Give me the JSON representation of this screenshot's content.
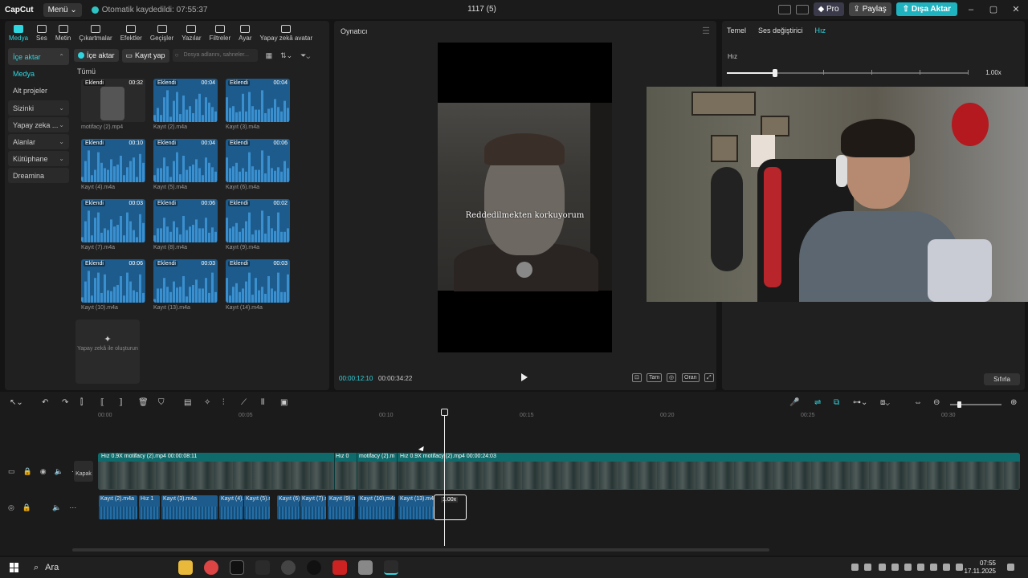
{
  "titlebar": {
    "logo": "CapCut",
    "menu": "Menü",
    "autosave": "Otomatik kaydedildi: 07:55:37",
    "project": "1117 (5)",
    "pro": "Pro",
    "share": "Paylaş",
    "export": "Dışa Aktar"
  },
  "toptabs": [
    {
      "label": "Medya",
      "icon": "media-icon",
      "active": true
    },
    {
      "label": "Ses",
      "icon": "audio-icon"
    },
    {
      "label": "Metin",
      "icon": "text-icon"
    },
    {
      "label": "Çıkartmalar",
      "icon": "sticker-icon"
    },
    {
      "label": "Efektler",
      "icon": "effects-icon"
    },
    {
      "label": "Geçişler",
      "icon": "transitions-icon"
    },
    {
      "label": "Yazılar",
      "icon": "captions-icon"
    },
    {
      "label": "Filtreler",
      "icon": "filters-icon"
    },
    {
      "label": "Ayar",
      "icon": "adjust-icon"
    },
    {
      "label": "Yapay zekâ avatar",
      "icon": "avatar-icon"
    }
  ],
  "sidenav": [
    {
      "label": "İçe aktar",
      "chevron": "^",
      "selected": true
    },
    {
      "label": "Medya",
      "highlight": true
    },
    {
      "label": "Alt projeler"
    },
    {
      "label": "Sizinki",
      "chevron": "v",
      "box": true
    },
    {
      "label": "Yapay zeka ...",
      "chevron": "v",
      "box": true
    },
    {
      "label": "Alanlar",
      "chevron": "v",
      "box": true
    },
    {
      "label": "Kütüphane",
      "chevron": "v",
      "box": true
    },
    {
      "label": "Dreamina",
      "box": true
    }
  ],
  "media_toolbar": {
    "import": "İçe aktar",
    "record": "Kayıt yap",
    "search_placeholder": "Dosya adlarını, sahneler..."
  },
  "section_label": "Tümü",
  "added_label": "Eklendi",
  "media": [
    {
      "name": "motifacy (2).mp4",
      "duration": "00:32",
      "type": "video"
    },
    {
      "name": "Kayıt (2).m4a",
      "duration": "00:04",
      "type": "audio"
    },
    {
      "name": "Kayıt (3).m4a",
      "duration": "00:04",
      "type": "audio"
    },
    {
      "name": "Kayıt (4).m4a",
      "duration": "00:10",
      "type": "audio"
    },
    {
      "name": "Kayıt (5).m4a",
      "duration": "00:04",
      "type": "audio"
    },
    {
      "name": "Kayıt (6).m4a",
      "duration": "00:06",
      "type": "audio"
    },
    {
      "name": "Kayıt (7).m4a",
      "duration": "00:03",
      "type": "audio"
    },
    {
      "name": "Kayıt (8).m4a",
      "duration": "00:06",
      "type": "audio"
    },
    {
      "name": "Kayıt (9).m4a",
      "duration": "00:02",
      "type": "audio"
    },
    {
      "name": "Kayıt (10).m4a",
      "duration": "00:06",
      "type": "audio"
    },
    {
      "name": "Kayıt (13).m4a",
      "duration": "00:03",
      "type": "audio"
    },
    {
      "name": "Kayıt (14).m4a",
      "duration": "00:03",
      "type": "audio"
    }
  ],
  "ai_generate": "Yapay zekâ ile oluşturun",
  "player": {
    "title": "Oynatıcı",
    "caption": "Reddedilmekten korkuyorum",
    "current_time": "00:00:12:10",
    "total_time": "00:00:34:22",
    "full_label": "Tam",
    "ratio_label": "Oran"
  },
  "right_panel": {
    "tabs": [
      "Temel",
      "Ses değiştirici",
      "Hız"
    ],
    "speed_label": "Hız",
    "speed_value": "1.00x",
    "speed_fraction": 0.2,
    "reset": "Sıfırla"
  },
  "timeline": {
    "ruler": [
      "00:00",
      "00:05",
      "00:10",
      "00:15",
      "00:20",
      "00:25",
      "00:30"
    ],
    "cover": "Kapak",
    "video_labels": [
      "Hız 0.9X   motifacy (2).mp4   00:00:08:11",
      "Hız 0",
      "motifacy (2).m",
      "Hız 0.9X   motifacy (2).mp4   00:00:24:03"
    ],
    "audio_clips": [
      "Kayıt (2).m4a",
      "Hız 1",
      "Kayıt (3).m4a",
      "Kayıt (4).n",
      "Kayıt (5).n",
      "Kayıt (6)",
      "Kayıt (7).m",
      "Kayıt (9).m",
      "Kayıt (10).m4a",
      "Kayıt (13).m4a"
    ],
    "selected_speed": "1.00x"
  },
  "taskbar": {
    "search": "Ara",
    "time": "07:55",
    "date": "17.11.2025"
  }
}
